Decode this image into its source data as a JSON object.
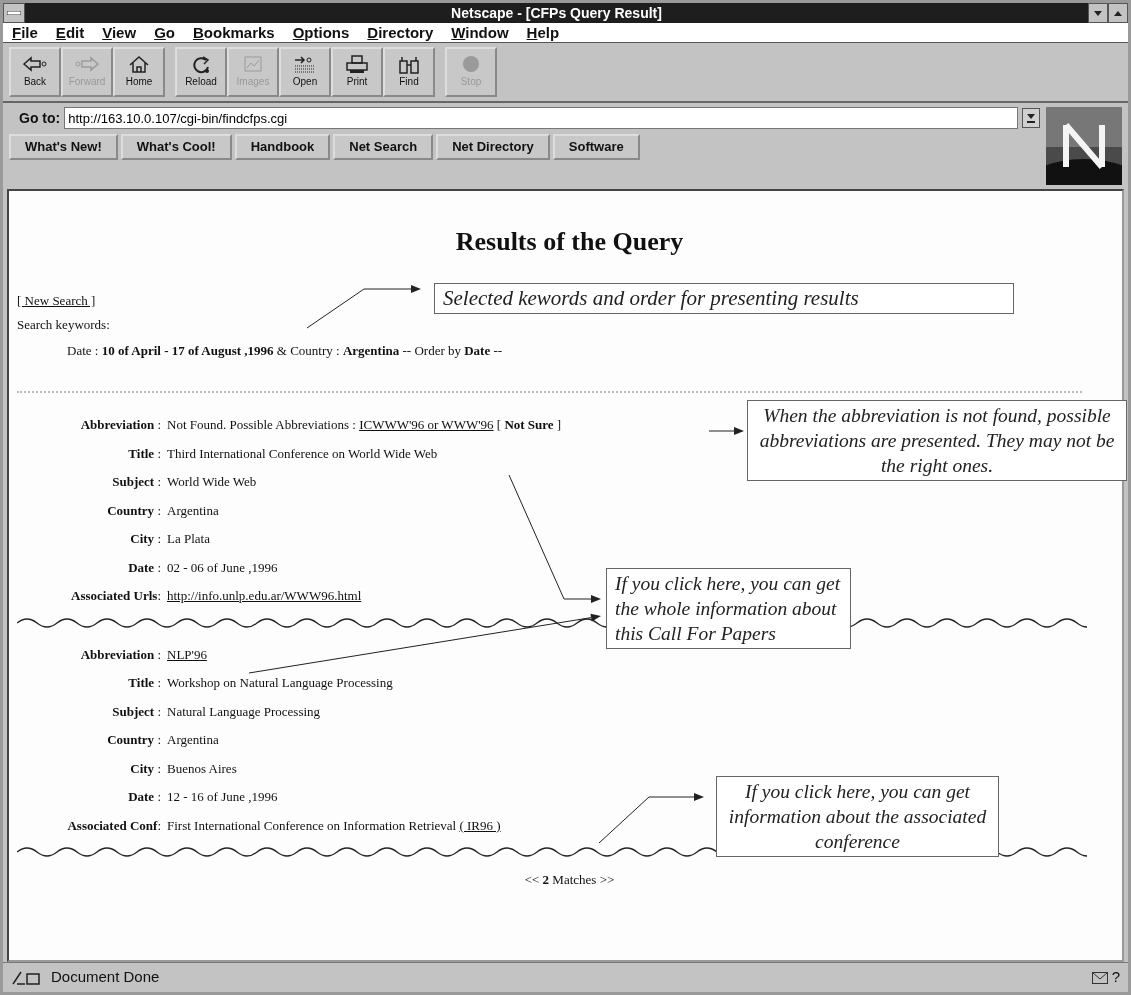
{
  "window": {
    "title": "Netscape - [CFPs Query Result]"
  },
  "menu": [
    "File",
    "Edit",
    "View",
    "Go",
    "Bookmarks",
    "Options",
    "Directory",
    "Window",
    "Help"
  ],
  "toolbar_groups": [
    [
      {
        "label": "Back",
        "disabled": false
      },
      {
        "label": "Forward",
        "disabled": true
      },
      {
        "label": "Home",
        "disabled": false
      }
    ],
    [
      {
        "label": "Reload",
        "disabled": false
      },
      {
        "label": "Images",
        "disabled": true
      },
      {
        "label": "Open",
        "disabled": false
      },
      {
        "label": "Print",
        "disabled": false
      },
      {
        "label": "Find",
        "disabled": false
      }
    ],
    [
      {
        "label": "Stop",
        "disabled": true
      }
    ]
  ],
  "location": {
    "label": "Go to:",
    "value": "http://163.10.0.107/cgi-bin/findcfps.cgi"
  },
  "directory_buttons": [
    "What's New!",
    "What's Cool!",
    "Handbook",
    "Net Search",
    "Net Directory",
    "Software"
  ],
  "page": {
    "heading": "Results of the Query",
    "new_search": "[ New Search ]",
    "keywords_label": "Search keywords:",
    "keywords": "Date : **10 of April - 17 of August ,1996** & Country : **Argentina** -- Order by **Date** --",
    "records": [
      {
        "fields": [
          {
            "label": "**Abbreviation** :",
            "parts": [
              {
                "kind": "text",
                "text": "Not Found. Possible Abbreviations :"
              },
              {
                "kind": "link",
                "text": "ICWWW'96 or WWW'96"
              },
              {
                "kind": "text",
                "text": "[ **Not Sure** ]"
              }
            ]
          },
          {
            "label": "**Title** :",
            "parts": [
              {
                "kind": "text",
                "text": "Third International Conference on World Wide Web"
              }
            ]
          },
          {
            "label": "**Subject** :",
            "parts": [
              {
                "kind": "text",
                "text": "World Wide Web"
              }
            ]
          },
          {
            "label": "**Country** :",
            "parts": [
              {
                "kind": "text",
                "text": "Argentina"
              }
            ]
          },
          {
            "label": "**City** :",
            "parts": [
              {
                "kind": "text",
                "text": "La Plata"
              }
            ]
          },
          {
            "label": "**Date** :",
            "parts": [
              {
                "kind": "text",
                "text": "02 - 06 of June ,1996"
              }
            ]
          },
          {
            "label": "**Associated Urls**:",
            "parts": [
              {
                "kind": "link",
                "text": "http://info.unlp.edu.ar/WWW96.html"
              }
            ]
          }
        ]
      },
      {
        "fields": [
          {
            "label": "**Abbreviation** :",
            "parts": [
              {
                "kind": "link",
                "text": "NLP'96"
              }
            ]
          },
          {
            "label": "**Title** :",
            "parts": [
              {
                "kind": "text",
                "text": "Workshop on Natural Language Processing"
              }
            ]
          },
          {
            "label": "**Subject** :",
            "parts": [
              {
                "kind": "text",
                "text": "Natural Language Processing"
              }
            ]
          },
          {
            "label": "**Country** :",
            "parts": [
              {
                "kind": "text",
                "text": "Argentina"
              }
            ]
          },
          {
            "label": "**City** :",
            "parts": [
              {
                "kind": "text",
                "text": "Buenos Aires"
              }
            ]
          },
          {
            "label": "**Date** :",
            "parts": [
              {
                "kind": "text",
                "text": "12 - 16 of June ,1996"
              }
            ]
          },
          {
            "label": "**Associated Conf**:",
            "parts": [
              {
                "kind": "text",
                "text": "First International Conference on Information Retrieval"
              },
              {
                "kind": "link",
                "text": "( IR96 )"
              }
            ]
          }
        ]
      }
    ],
    "matches": "<< **2** Matches >>"
  },
  "callouts": [
    "Selected kewords and order for presenting results",
    "When the abbreviation is not found, possible abbreviations are presented. They may not be the right ones.",
    "If you click here, you can get the whole information about this Call For Papers",
    "If you click here, you can get information about the associated conference"
  ],
  "status_bar": {
    "text": "Document Done",
    "help": "?"
  }
}
